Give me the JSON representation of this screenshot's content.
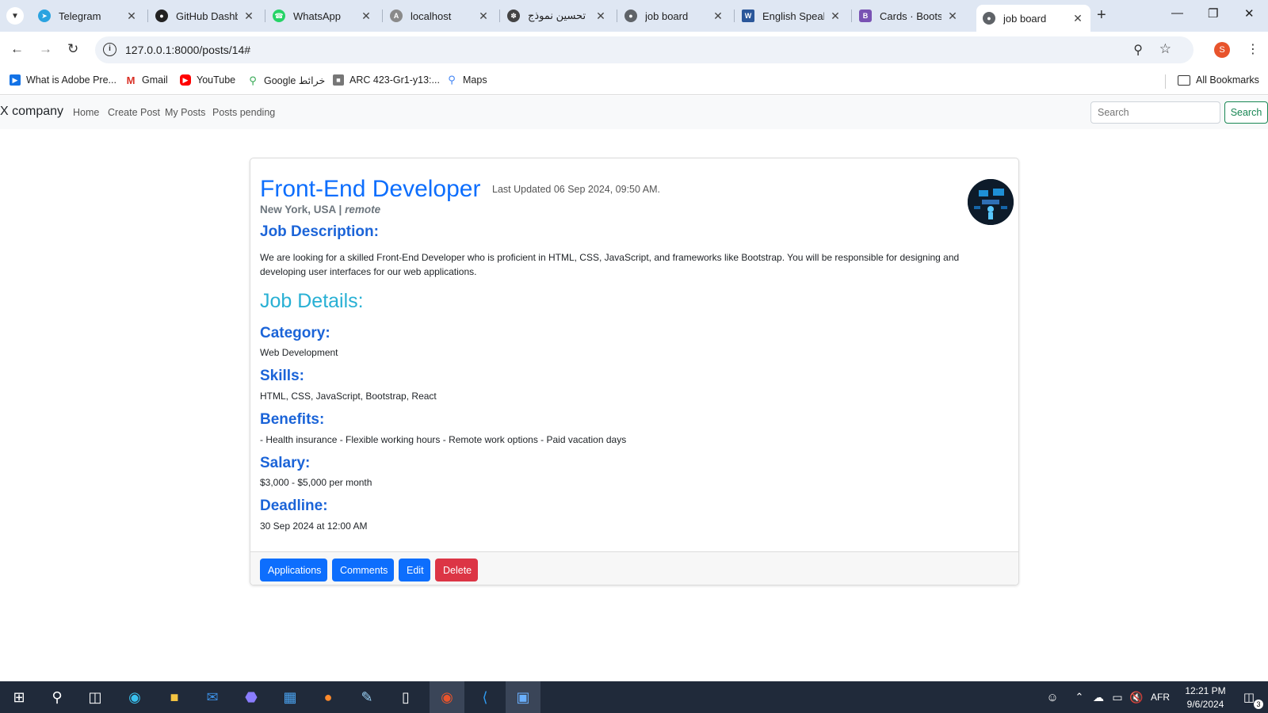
{
  "browser": {
    "tabs": [
      {
        "title": "Telegram",
        "icon": "telegram-icon",
        "color": "#2aa3e0"
      },
      {
        "title": "GitHub Dashboard",
        "icon": "github-icon",
        "color": "#222222"
      },
      {
        "title": "WhatsApp",
        "icon": "whatsapp-icon",
        "color": "#25d366"
      },
      {
        "title": "localhost",
        "icon": "angular-icon",
        "color": "#777777"
      },
      {
        "title": "تحسين نموذج",
        "icon": "openai-icon",
        "color": "#444444"
      },
      {
        "title": "job board",
        "icon": "globe-icon",
        "color": "#5f6368"
      },
      {
        "title": "English Speaker",
        "icon": "word-icon",
        "color": "#2b579a"
      },
      {
        "title": "Cards · Bootstrap",
        "icon": "bootstrap-icon",
        "color": "#7952b3"
      },
      {
        "title": "job board",
        "icon": "globe-icon",
        "color": "#5f6368"
      }
    ],
    "url": "127.0.0.1:8000/posts/14#",
    "profile_initial": "S",
    "bookmarks": [
      {
        "label": "What is Adobe Pre...",
        "icon": "adobe-icon"
      },
      {
        "label": "Gmail",
        "icon": "gmail-icon"
      },
      {
        "label": "YouTube",
        "icon": "youtube-icon"
      },
      {
        "label": "Google خرائط",
        "icon": "maps-pin-icon"
      },
      {
        "label": "ARC 423-Gr1-y13:...",
        "icon": "building-icon"
      },
      {
        "label": "Maps",
        "icon": "maps-pin-icon"
      }
    ],
    "all_bookmarks": "All Bookmarks"
  },
  "site": {
    "brand": "X company",
    "nav": [
      "Home",
      "Create Post",
      "My Posts",
      "Posts pending"
    ],
    "search_placeholder": "Search",
    "search_button": "Search"
  },
  "post": {
    "title": "Front-End Developer",
    "updated": "Last Updated 06 Sep 2024, 09:50 AM.",
    "location": "New York, USA",
    "separator": "|",
    "work_mode": "remote",
    "description_heading": "Job Description:",
    "description": "We are looking for a skilled Front-End Developer who is proficient in HTML, CSS, JavaScript, and frameworks like Bootstrap. You will be responsible for designing and developing user interfaces for our web applications.",
    "details_heading": "Job Details:",
    "category_heading": "Category:",
    "category": "Web Development",
    "skills_heading": "Skills:",
    "skills": "HTML, CSS, JavaScript, Bootstrap, React",
    "benefits_heading": "Benefits:",
    "benefits": "- Health insurance - Flexible working hours - Remote work options - Paid vacation days",
    "salary_heading": "Salary:",
    "salary": "$3,000 - $5,000 per month",
    "deadline_heading": "Deadline:",
    "deadline": "30 Sep 2024 at 12:00 AM",
    "actions": {
      "applications": "Applications",
      "comments": "Comments",
      "edit": "Edit",
      "delete": "Delete"
    }
  },
  "taskbar": {
    "language": "AFR",
    "time": "12:21 PM",
    "date": "9/6/2024",
    "notifications": "3"
  }
}
